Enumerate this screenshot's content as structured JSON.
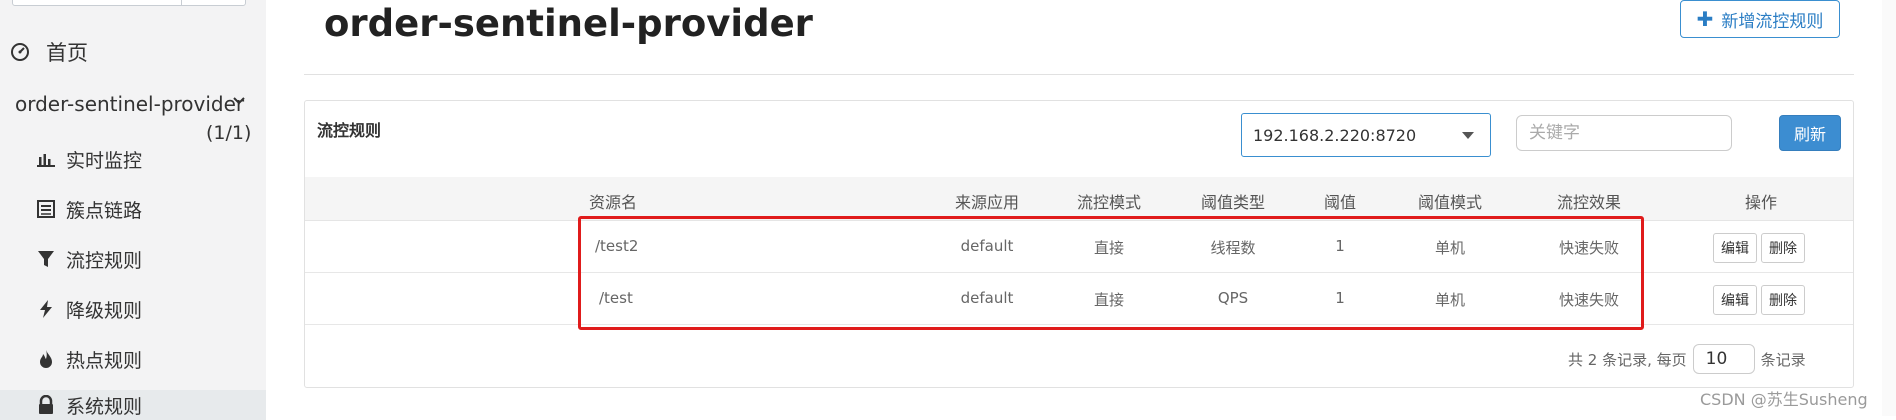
{
  "sidebar": {
    "home_label": "首页",
    "app_name": "order-sentinel-provider",
    "app_count": "(1/1)",
    "items": [
      {
        "label": "实时监控",
        "icon": "bar-chart-icon"
      },
      {
        "label": "簇点链路",
        "icon": "list-icon"
      },
      {
        "label": "流控规则",
        "icon": "filter-icon"
      },
      {
        "label": "降级规则",
        "icon": "bolt-icon"
      },
      {
        "label": "热点规则",
        "icon": "fire-icon"
      },
      {
        "label": "系统规则",
        "icon": "lock-icon"
      }
    ]
  },
  "header": {
    "title": "order-sentinel-provider",
    "add_button_label": "新增流控规则"
  },
  "panel": {
    "title": "流控规则",
    "machine_selected": "192.168.2.220:8720",
    "keyword_placeholder": "关键字",
    "refresh_label": "刷新"
  },
  "table": {
    "columns": [
      "资源名",
      "来源应用",
      "流控模式",
      "阈值类型",
      "阈值",
      "阈值模式",
      "流控效果",
      "操作"
    ],
    "rows": [
      {
        "resource": "/test2",
        "origin": "default",
        "mode": "直接",
        "grade": "线程数",
        "count": "1",
        "cluster": "单机",
        "effect": "快速失败"
      },
      {
        "resource": "/test",
        "origin": "default",
        "mode": "直接",
        "grade": "QPS",
        "count": "1",
        "cluster": "单机",
        "effect": "快速失败"
      }
    ],
    "edit_label": "编辑",
    "delete_label": "删除"
  },
  "pagination": {
    "summary": "共 2 条记录, 每页",
    "page_size": "10",
    "suffix": "条记录"
  },
  "watermark": "CSDN @苏生Susheng",
  "colors": {
    "accent": "#3c8dd1",
    "highlight": "#e01b1b"
  }
}
